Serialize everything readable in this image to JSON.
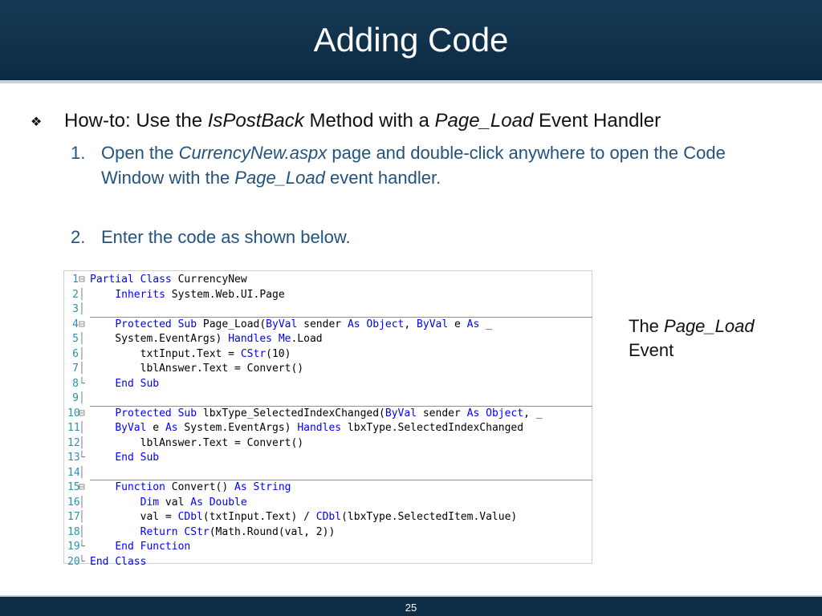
{
  "slide": {
    "title": "Adding Code",
    "page_number": "25"
  },
  "main_bullet": {
    "prefix": "How-to: Use the ",
    "italic1": "IsPostBack",
    "mid": " Method with a ",
    "italic2": "Page_Load",
    "suffix": " Event Handler"
  },
  "steps": [
    {
      "num": "1.",
      "parts": {
        "a": "Open the ",
        "b": "CurrencyNew.aspx",
        "c": " page and double-click anywhere to open the Code Window with the ",
        "d": "Page_Load",
        "e": " event handler."
      }
    },
    {
      "num": "2.",
      "text": "Enter the code as shown below."
    }
  ],
  "code": {
    "line_numbers": [
      "1",
      "2",
      "3",
      "4",
      "5",
      "6",
      "7",
      "8",
      "9",
      "10",
      "11",
      "12",
      "13",
      "14",
      "15",
      "16",
      "17",
      "18",
      "19",
      "20"
    ],
    "lines": [
      "Partial Class CurrencyNew",
      "    Inherits System.Web.UI.Page",
      "",
      "    Protected Sub Page_Load(ByVal sender As Object, ByVal e As _",
      "    System.EventArgs) Handles Me.Load",
      "        txtInput.Text = CStr(10)",
      "        lblAnswer.Text = Convert()",
      "    End Sub",
      "",
      "    Protected Sub lbxType_SelectedIndexChanged(ByVal sender As Object, _",
      "    ByVal e As System.EventArgs) Handles lbxType.SelectedIndexChanged",
      "        lblAnswer.Text = Convert()",
      "    End Sub",
      "",
      "    Function Convert() As String",
      "        Dim val As Double",
      "        val = CDbl(txtInput.Text) / CDbl(lbxType.SelectedItem.Value)",
      "        Return CStr(Math.Round(val, 2))",
      "    End Function",
      "End Class"
    ]
  },
  "side_note": {
    "prefix": "The ",
    "italic": "Page_Load",
    "line2": "Event"
  }
}
